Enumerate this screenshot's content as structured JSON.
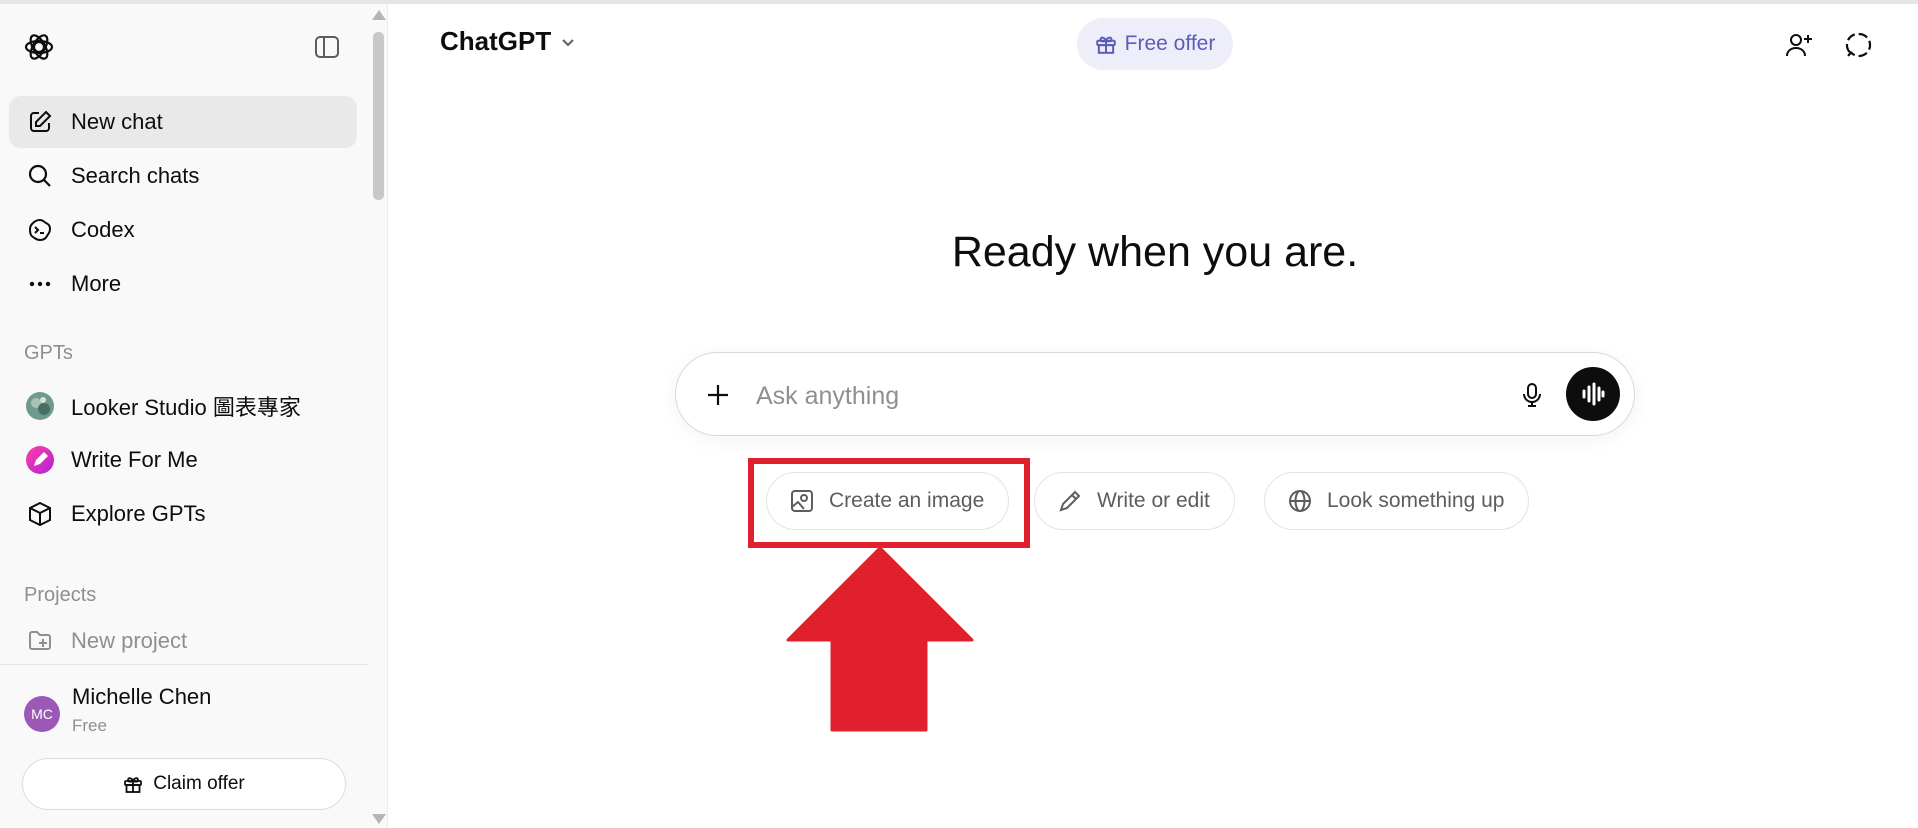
{
  "sidebar": {
    "items": [
      {
        "label": "New chat",
        "icon": "edit-icon"
      },
      {
        "label": "Search chats",
        "icon": "search-icon"
      },
      {
        "label": "Codex",
        "icon": "codex-icon"
      },
      {
        "label": "More",
        "icon": "more-icon"
      }
    ],
    "gpts_heading": "GPTs",
    "gpts": [
      {
        "label": "Looker Studio 圖表專家",
        "icon": "gpt-avatar-looker"
      },
      {
        "label": "Write For Me",
        "icon": "gpt-avatar-pencil"
      },
      {
        "label": "Explore GPTs",
        "icon": "cube-icon"
      }
    ],
    "projects_heading": "Projects",
    "new_project": "New project",
    "user": {
      "initials": "MC",
      "name": "Michelle Chen",
      "plan": "Free"
    },
    "claim_offer": "Claim offer"
  },
  "header": {
    "model": "ChatGPT",
    "free_offer": "Free offer"
  },
  "main": {
    "headline": "Ready when you are.",
    "composer_placeholder": "Ask anything",
    "chips": [
      {
        "label": "Create an image",
        "icon": "image-icon"
      },
      {
        "label": "Write or edit",
        "icon": "pencil-icon"
      },
      {
        "label": "Look something up",
        "icon": "globe-icon"
      }
    ]
  },
  "colors": {
    "annotation_red": "#e2202d",
    "free_offer_bg": "#eeeefb",
    "free_offer_text": "#5c5cb8",
    "avatar_purple": "#9b59b6"
  }
}
